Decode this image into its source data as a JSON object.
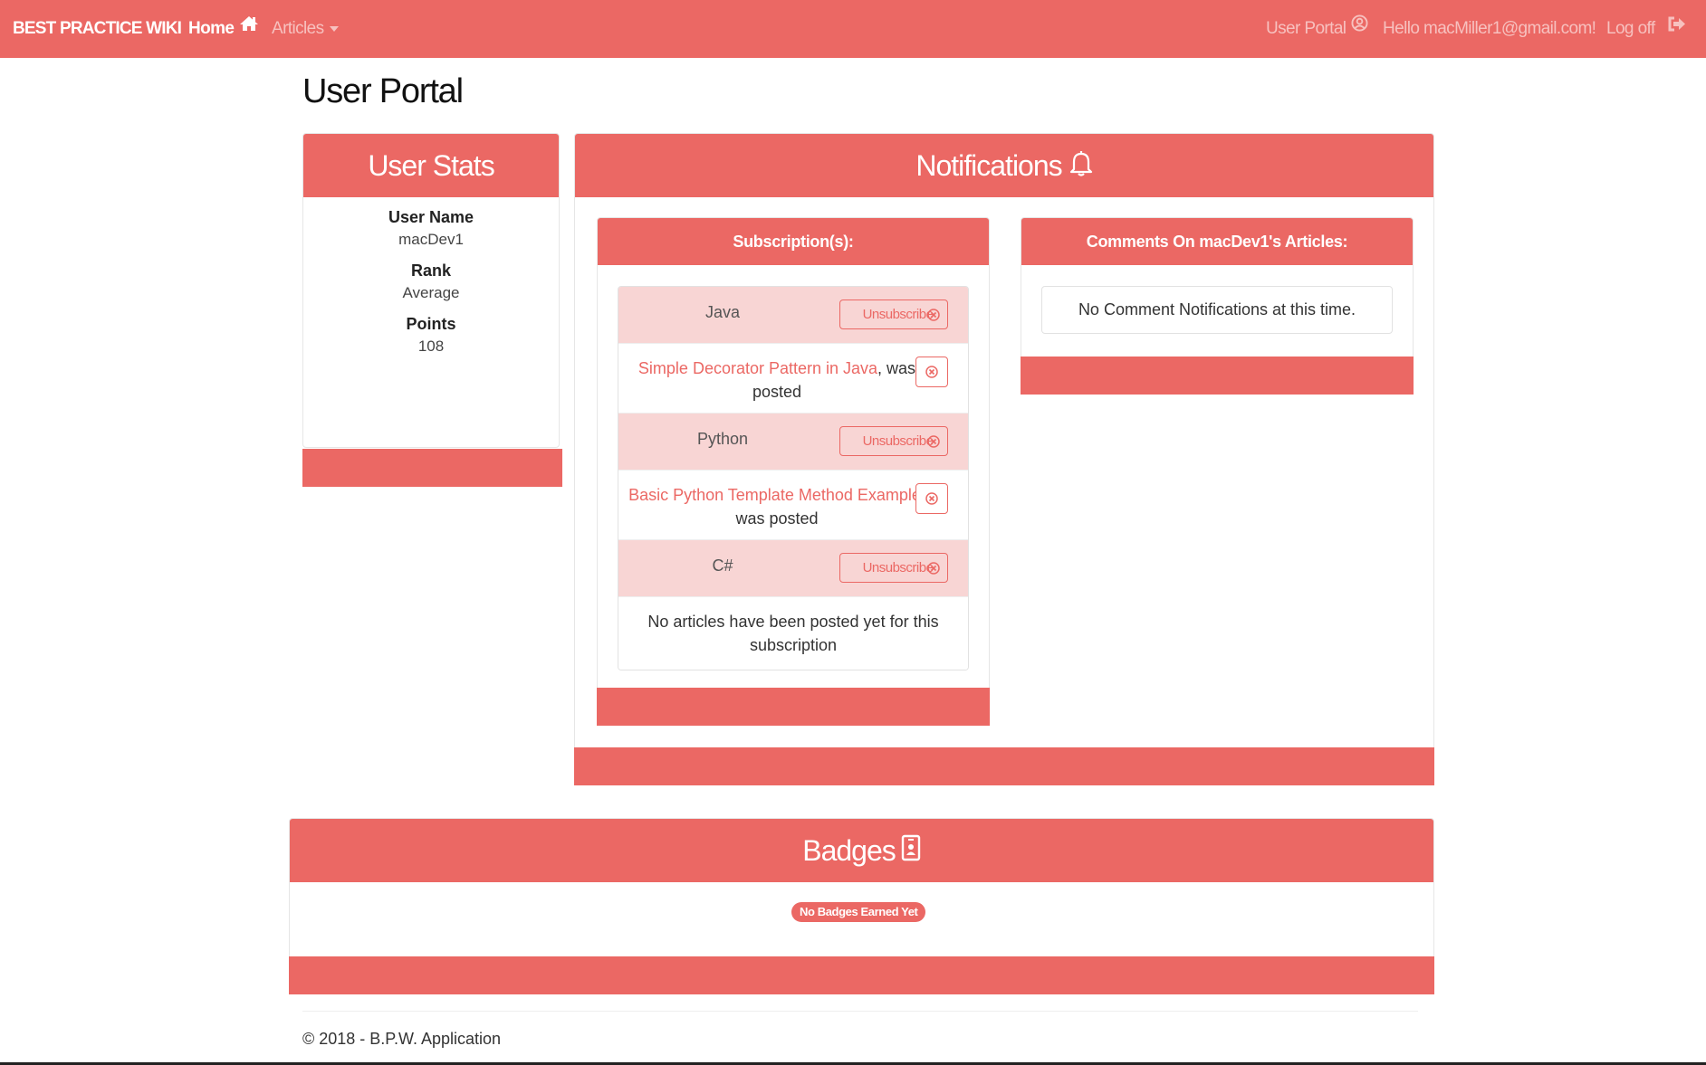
{
  "navbar": {
    "brand": "BEST PRACTICE WIKI",
    "home": "Home",
    "articles": "Articles",
    "user_portal": "User Portal",
    "greeting": "Hello macMiller1@gmail.com!",
    "logoff": "Log off",
    "icons": {
      "home": "home-icon",
      "articles": "caret-down-icon",
      "portal": "user-circle-icon",
      "logoff": "sign-out-icon"
    }
  },
  "page": {
    "title": "User Portal"
  },
  "user_stats": {
    "title": "User Stats",
    "fields": [
      {
        "label": "User Name",
        "value": "macDev1"
      },
      {
        "label": "Rank",
        "value": "Average"
      },
      {
        "label": "Points",
        "value": "108"
      }
    ]
  },
  "notifications": {
    "title": "Notifications",
    "icon": "bell-icon",
    "subscriptions": {
      "title": "Subscription(s):",
      "unsubscribe_label": "Unsubscribe",
      "items": [
        {
          "name": "Java",
          "article": "Simple Decorator Pattern in Java",
          "suffix": ", was posted"
        },
        {
          "name": "Python",
          "article": "Basic Python Template Method Example",
          "suffix": ", was posted"
        },
        {
          "name": "C#",
          "empty": "No articles have been posted yet for this subscription"
        }
      ]
    },
    "comments": {
      "title": "Comments On macDev1's Articles:",
      "empty": "No Comment Notifications at this time."
    }
  },
  "badges": {
    "title": "Badges",
    "icon": "id-badge-icon",
    "empty": "No Badges Earned Yet"
  },
  "footer": {
    "text": "© 2018 - B.P.W. Application"
  },
  "colors": {
    "brand": "#eb6864",
    "nav_muted": "#f7c1bf",
    "row_highlight": "#f8d5d4"
  }
}
